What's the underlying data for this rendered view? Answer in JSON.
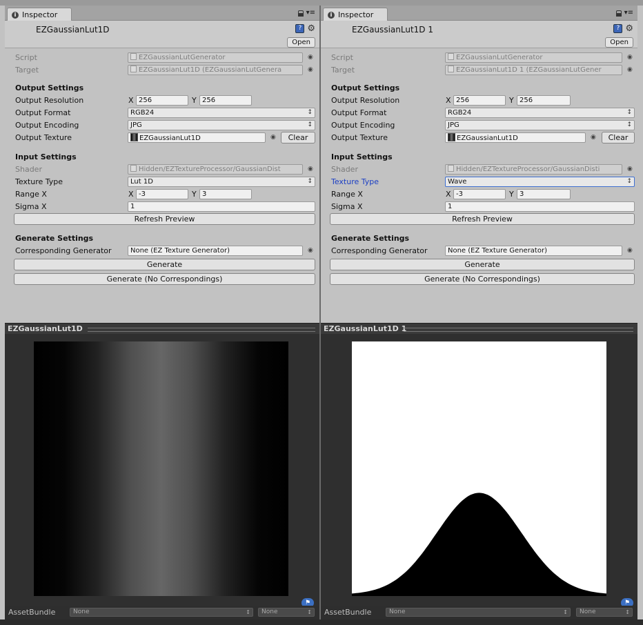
{
  "left": {
    "tab_label": "Inspector",
    "object_title": "EZGaussianLut1D",
    "open_label": "Open",
    "script_label": "Script",
    "script_value": "EZGaussianLutGenerator",
    "target_label": "Target",
    "target_value": "EZGaussianLut1D (EZGaussianLutGenera",
    "output_settings": "Output Settings",
    "output_resolution_label": "Output Resolution",
    "res_x_label": "X",
    "res_x": "256",
    "res_y_label": "Y",
    "res_y": "256",
    "output_format_label": "Output Format",
    "output_format": "RGB24",
    "output_encoding_label": "Output Encoding",
    "output_encoding": "JPG",
    "output_texture_label": "Output Texture",
    "output_texture": "EZGaussianLut1D",
    "clear_label": "Clear",
    "input_settings": "Input Settings",
    "shader_label": "Shader",
    "shader_value": "Hidden/EZTextureProcessor/GaussianDist",
    "texture_type_label": "Texture Type",
    "texture_type": "Lut 1D",
    "range_x_label": "Range X",
    "range_x_label_x": "X",
    "range_x_min": "-3",
    "range_x_label_y": "Y",
    "range_x_max": "3",
    "sigma_x_label": "Sigma X",
    "sigma_x": "1",
    "refresh_preview": "Refresh Preview",
    "generate_settings": "Generate Settings",
    "corresponding_label": "Corresponding Generator",
    "corresponding_value": "None (EZ Texture Generator)",
    "generate": "Generate",
    "generate_no_corr": "Generate (No Correspondings)",
    "preview_title": "EZGaussianLut1D",
    "asset_bundle_label": "AssetBundle",
    "asset_bundle": "None",
    "asset_variant": "None"
  },
  "right": {
    "tab_label": "Inspector",
    "object_title": "EZGaussianLut1D 1",
    "open_label": "Open",
    "script_label": "Script",
    "script_value": "EZGaussianLutGenerator",
    "target_label": "Target",
    "target_value": "EZGaussianLut1D 1 (EZGaussianLutGener",
    "output_settings": "Output Settings",
    "output_resolution_label": "Output Resolution",
    "res_x_label": "X",
    "res_x": "256",
    "res_y_label": "Y",
    "res_y": "256",
    "output_format_label": "Output Format",
    "output_format": "RGB24",
    "output_encoding_label": "Output Encoding",
    "output_encoding": "JPG",
    "output_texture_label": "Output Texture",
    "output_texture": "EZGaussianLut1D",
    "clear_label": "Clear",
    "input_settings": "Input Settings",
    "shader_label": "Shader",
    "shader_value": "Hidden/EZTextureProcessor/GaussianDisti",
    "texture_type_label": "Texture Type",
    "texture_type": "Wave",
    "range_x_label": "Range X",
    "range_x_label_x": "X",
    "range_x_min": "-3",
    "range_x_label_y": "Y",
    "range_x_max": "3",
    "sigma_x_label": "Sigma X",
    "sigma_x": "1",
    "refresh_preview": "Refresh Preview",
    "generate_settings": "Generate Settings",
    "corresponding_label": "Corresponding Generator",
    "corresponding_value": "None (EZ Texture Generator)",
    "generate": "Generate",
    "generate_no_corr": "Generate (No Correspondings)",
    "preview_title": "EZGaussianLut1D 1",
    "asset_bundle_label": "AssetBundle",
    "asset_bundle": "None",
    "asset_variant": "None"
  },
  "icons": {
    "info": "info-icon",
    "lock": "lock-icon",
    "menu": "menu-icon",
    "help": "help-icon",
    "gear": "gear-icon",
    "picker": "object-picker-icon",
    "tag": "asset-label-icon"
  },
  "colors": {
    "panel_bg": "#c2c2c2",
    "focus_blue": "#3d6fd1",
    "label_blue": "#1b3fc4",
    "preview_bg": "#2f2f2f"
  }
}
